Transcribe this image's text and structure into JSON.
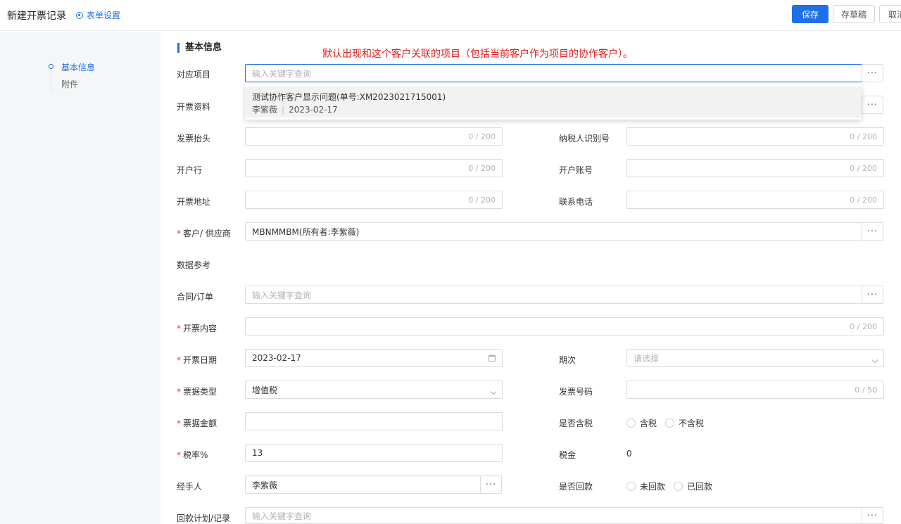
{
  "header": {
    "title": "新建开票记录",
    "form_settings": "表单设置",
    "save": "保存",
    "draft": "存草稿",
    "cancel": "取消"
  },
  "sidebar": {
    "items": [
      {
        "label": "基本信息",
        "active": true
      },
      {
        "label": "附件",
        "active": false
      }
    ]
  },
  "section_title": "基本信息",
  "annotation": "默认出现和这个客户关联的项目（包括当前客户作为项目的协作客户）。",
  "dropdown": {
    "title": "测试协作客户显示问题(单号:XM2023021715001)",
    "owner": "李紫薇",
    "date": "2023-02-17"
  },
  "fields": {
    "project": {
      "label": "对应项目",
      "placeholder": "输入关键字查询"
    },
    "invoice_info": {
      "label": "开票资料"
    },
    "invoice_title": {
      "label": "发票抬头",
      "counter": "0 / 200"
    },
    "taxpayer_id": {
      "label": "纳税人识别号",
      "counter": "0 / 200"
    },
    "bank": {
      "label": "开户行",
      "counter": "0 / 200"
    },
    "account": {
      "label": "开户账号",
      "counter": "0 / 200"
    },
    "address": {
      "label": "开票地址",
      "counter": "0 / 200"
    },
    "phone": {
      "label": "联系电话",
      "counter": "0 / 200"
    },
    "customer": {
      "label": "客户/ 供应商",
      "required": "*",
      "value": "MBNMMBM(所有者:李紫薇)"
    },
    "data_ref": {
      "label": "数据参考"
    },
    "contract": {
      "label": "合同/订单",
      "placeholder": "输入关键字查询"
    },
    "content": {
      "label": "开票内容",
      "required": "*",
      "counter": "0 / 200"
    },
    "date": {
      "label": "开票日期",
      "required": "*",
      "value": "2023-02-17"
    },
    "period": {
      "label": "期次",
      "placeholder": "请选择"
    },
    "bill_type": {
      "label": "票据类型",
      "required": "*",
      "value": "增值税"
    },
    "invoice_no": {
      "label": "发票号码",
      "counter": "0 / 50"
    },
    "amount": {
      "label": "票据金额",
      "required": "*"
    },
    "tax_included": {
      "label": "是否含税",
      "options": [
        "含税",
        "不含税"
      ]
    },
    "tax_rate": {
      "label": "税率%",
      "required": "*",
      "value": "13"
    },
    "tax": {
      "label": "税金",
      "value": "0"
    },
    "handler": {
      "label": "经手人",
      "value": "李紫薇"
    },
    "repaid": {
      "label": "是否回款",
      "options": [
        "未回款",
        "已回款"
      ]
    },
    "repay_plan": {
      "label": "回款计划/记录",
      "placeholder": "输入关键字查询"
    }
  },
  "more_button": "···"
}
